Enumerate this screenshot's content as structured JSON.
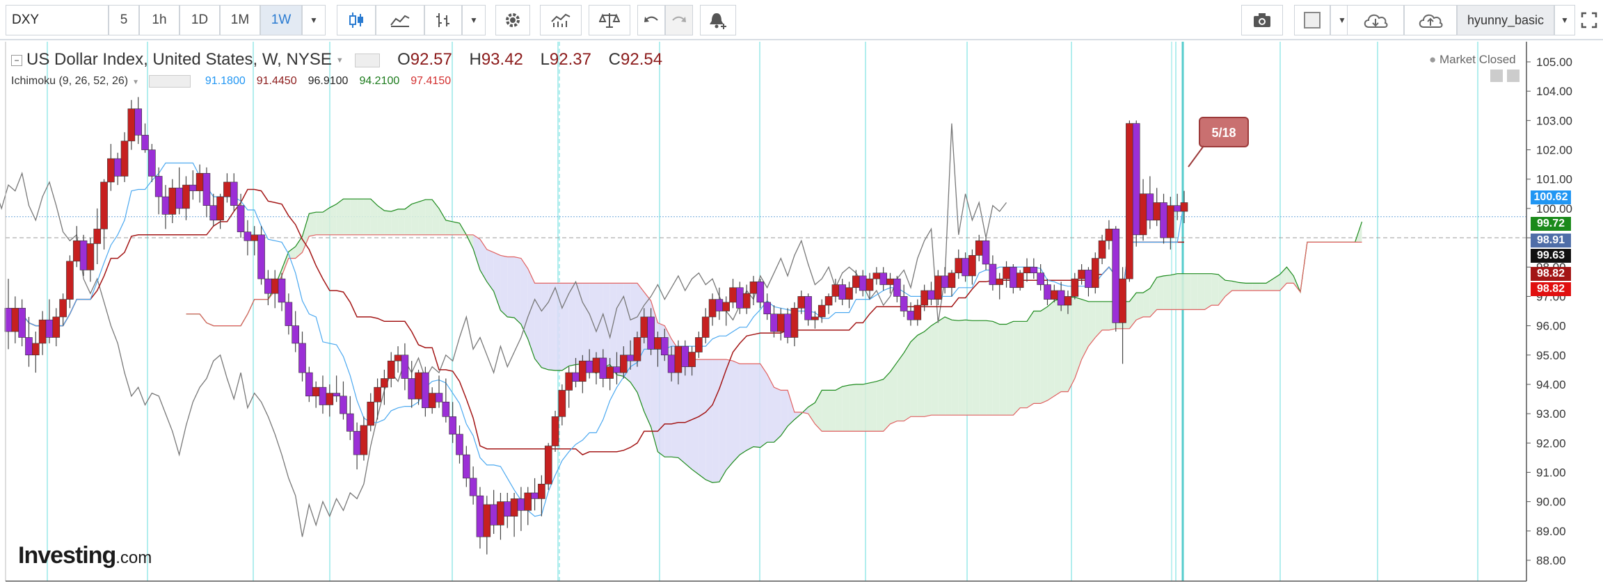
{
  "toolbar": {
    "symbol": "DXY",
    "intervals": [
      "5",
      "1h",
      "1D",
      "1M",
      "1W"
    ],
    "active_interval": "1W",
    "user": "hyunny_basic"
  },
  "legend": {
    "title": "US Dollar Index, United States, W, NYSE",
    "open_label": "O",
    "open": "92.57",
    "high_label": "H",
    "high": "93.42",
    "low_label": "L",
    "low": "92.37",
    "close_label": "C",
    "close": "92.54",
    "indicator": "Ichimoku (9, 26, 52, 26)",
    "indicator_values": [
      {
        "value": "91.1800",
        "color": "#2196f3"
      },
      {
        "value": "91.4450",
        "color": "#8b1a1a"
      },
      {
        "value": "96.9100",
        "color": "#222222"
      },
      {
        "value": "94.2100",
        "color": "#1b7a1b"
      },
      {
        "value": "97.4150",
        "color": "#d32f2f"
      }
    ]
  },
  "status": "Market Closed",
  "callout": "5/18",
  "brand": {
    "name": "Investing",
    "suffix": ".com"
  },
  "price_tags": [
    {
      "value": "100.62",
      "color": "#2196f3"
    },
    {
      "value": "99.72",
      "color": "#1b8a1b"
    },
    {
      "value": "98.91",
      "color": "#4f6ea8"
    },
    {
      "value": "99.63",
      "color": "#111111"
    },
    {
      "value": "98.82",
      "color": "#a31515"
    },
    {
      "value": "98.82",
      "color": "#e01010"
    }
  ],
  "chart_data": {
    "type": "candlestick",
    "y_axis_ticks": [
      "105.00",
      "104.00",
      "103.00",
      "102.00",
      "101.00",
      "100.00",
      "99.00",
      "98.00",
      "97.00",
      "96.00",
      "95.00",
      "94.00",
      "93.00",
      "92.00",
      "91.00",
      "90.00",
      "89.00",
      "88.00"
    ],
    "ylim": [
      87.5,
      105.5
    ],
    "ohlc": [
      [
        96.6,
        97.6,
        95.2,
        95.8
      ],
      [
        95.8,
        97.0,
        95.4,
        96.6
      ],
      [
        96.6,
        96.9,
        95.3,
        95.6
      ],
      [
        95.6,
        96.3,
        94.6,
        95.0
      ],
      [
        95.0,
        95.8,
        94.4,
        95.4
      ],
      [
        95.4,
        96.5,
        95.0,
        96.2
      ],
      [
        96.2,
        96.9,
        95.4,
        95.6
      ],
      [
        95.6,
        96.6,
        95.3,
        96.3
      ],
      [
        96.3,
        97.1,
        96.0,
        96.9
      ],
      [
        96.9,
        98.4,
        96.6,
        98.2
      ],
      [
        98.2,
        99.4,
        98.0,
        98.9
      ],
      [
        98.9,
        99.1,
        97.7,
        97.9
      ],
      [
        97.9,
        99.0,
        97.5,
        98.8
      ],
      [
        98.8,
        100.0,
        98.1,
        99.3
      ],
      [
        99.3,
        101.0,
        98.6,
        100.9
      ],
      [
        100.9,
        102.2,
        100.6,
        101.7
      ],
      [
        101.7,
        101.9,
        100.8,
        101.1
      ],
      [
        101.1,
        102.6,
        100.9,
        102.3
      ],
      [
        102.3,
        103.7,
        102.0,
        103.4
      ],
      [
        103.4,
        103.8,
        102.2,
        102.5
      ],
      [
        102.5,
        102.9,
        101.9,
        102.0
      ],
      [
        102.0,
        102.2,
        100.9,
        101.1
      ],
      [
        101.1,
        101.4,
        99.8,
        100.4
      ],
      [
        100.4,
        100.8,
        99.3,
        99.8
      ],
      [
        99.8,
        101.0,
        99.5,
        100.7
      ],
      [
        100.7,
        101.4,
        99.8,
        100.0
      ],
      [
        100.0,
        101.1,
        99.6,
        100.8
      ],
      [
        100.8,
        101.3,
        100.3,
        100.6
      ],
      [
        100.6,
        101.5,
        100.2,
        101.2
      ],
      [
        101.2,
        101.4,
        99.7,
        100.1
      ],
      [
        100.1,
        100.5,
        99.4,
        99.6
      ],
      [
        99.6,
        100.5,
        99.3,
        100.4
      ],
      [
        100.4,
        101.2,
        100.2,
        100.9
      ],
      [
        100.9,
        101.2,
        99.9,
        100.1
      ],
      [
        100.1,
        100.5,
        99.0,
        99.2
      ],
      [
        99.2,
        99.6,
        98.4,
        98.9
      ],
      [
        98.9,
        99.4,
        98.4,
        99.1
      ],
      [
        99.1,
        99.4,
        97.4,
        97.6
      ],
      [
        97.6,
        97.9,
        96.7,
        97.1
      ],
      [
        97.1,
        97.9,
        96.6,
        97.6
      ],
      [
        97.6,
        97.8,
        96.5,
        96.8
      ],
      [
        96.8,
        97.1,
        95.7,
        96.0
      ],
      [
        96.0,
        96.5,
        95.1,
        95.4
      ],
      [
        95.4,
        95.8,
        94.1,
        94.4
      ],
      [
        94.4,
        94.6,
        93.4,
        93.6
      ],
      [
        93.6,
        94.1,
        93.2,
        93.9
      ],
      [
        93.9,
        94.3,
        93.0,
        93.3
      ],
      [
        93.3,
        94.0,
        92.9,
        93.7
      ],
      [
        93.7,
        94.3,
        93.4,
        93.6
      ],
      [
        93.6,
        94.1,
        92.8,
        93.0
      ],
      [
        93.0,
        93.6,
        92.1,
        92.4
      ],
      [
        92.4,
        92.7,
        91.1,
        91.6
      ],
      [
        91.6,
        92.9,
        91.4,
        92.6
      ],
      [
        92.6,
        93.7,
        92.4,
        93.4
      ],
      [
        93.4,
        94.2,
        92.8,
        93.9
      ],
      [
        93.9,
        94.5,
        93.3,
        94.2
      ],
      [
        94.2,
        95.1,
        93.9,
        94.8
      ],
      [
        94.8,
        95.3,
        94.4,
        95.0
      ],
      [
        95.0,
        95.4,
        93.8,
        94.2
      ],
      [
        94.2,
        94.8,
        93.2,
        93.5
      ],
      [
        93.5,
        94.5,
        93.3,
        94.4
      ],
      [
        94.4,
        94.6,
        92.9,
        93.2
      ],
      [
        93.2,
        93.9,
        93.0,
        93.7
      ],
      [
        93.7,
        94.3,
        93.2,
        93.4
      ],
      [
        93.4,
        94.2,
        92.7,
        92.9
      ],
      [
        92.9,
        93.4,
        92.0,
        92.3
      ],
      [
        92.3,
        92.6,
        91.3,
        91.6
      ],
      [
        91.6,
        91.9,
        90.5,
        90.8
      ],
      [
        90.8,
        91.2,
        89.9,
        90.2
      ],
      [
        90.2,
        90.5,
        88.4,
        88.8
      ],
      [
        88.8,
        90.2,
        88.2,
        89.9
      ],
      [
        89.9,
        90.4,
        88.9,
        89.2
      ],
      [
        89.2,
        90.3,
        88.7,
        90.0
      ],
      [
        90.0,
        90.3,
        89.1,
        89.5
      ],
      [
        89.5,
        90.3,
        88.8,
        90.1
      ],
      [
        90.1,
        90.5,
        89.0,
        89.7
      ],
      [
        89.7,
        90.5,
        89.2,
        90.3
      ],
      [
        90.3,
        90.8,
        89.7,
        90.1
      ],
      [
        90.1,
        90.9,
        89.5,
        90.6
      ],
      [
        90.6,
        92.0,
        90.4,
        91.9
      ],
      [
        91.9,
        93.1,
        91.7,
        92.9
      ],
      [
        92.9,
        94.0,
        92.6,
        93.8
      ],
      [
        93.8,
        94.6,
        93.2,
        94.4
      ],
      [
        94.4,
        94.9,
        93.9,
        94.1
      ],
      [
        94.1,
        95.0,
        93.7,
        94.8
      ],
      [
        94.8,
        95.2,
        94.2,
        94.4
      ],
      [
        94.4,
        95.1,
        94.0,
        94.9
      ],
      [
        94.9,
        95.2,
        93.9,
        94.2
      ],
      [
        94.2,
        94.9,
        93.8,
        94.6
      ],
      [
        94.6,
        95.1,
        94.0,
        94.4
      ],
      [
        94.4,
        95.3,
        94.2,
        95.0
      ],
      [
        95.0,
        95.5,
        94.5,
        94.8
      ],
      [
        94.8,
        95.8,
        94.6,
        95.6
      ],
      [
        95.6,
        96.6,
        95.4,
        96.3
      ],
      [
        96.3,
        96.6,
        95.0,
        95.2
      ],
      [
        95.2,
        95.8,
        94.6,
        95.6
      ],
      [
        95.6,
        95.9,
        94.8,
        95.0
      ],
      [
        95.0,
        95.3,
        94.1,
        94.4
      ],
      [
        94.4,
        95.5,
        94.0,
        95.3
      ],
      [
        95.3,
        95.5,
        94.3,
        94.6
      ],
      [
        94.6,
        95.3,
        94.3,
        95.1
      ],
      [
        95.1,
        95.8,
        94.9,
        95.6
      ],
      [
        95.6,
        96.6,
        95.4,
        96.3
      ],
      [
        96.3,
        97.1,
        96.0,
        96.9
      ],
      [
        96.9,
        97.3,
        96.2,
        96.5
      ],
      [
        96.5,
        97.0,
        96.0,
        96.8
      ],
      [
        96.8,
        97.6,
        96.6,
        97.3
      ],
      [
        97.3,
        97.5,
        96.4,
        96.6
      ],
      [
        96.6,
        97.4,
        96.4,
        97.1
      ],
      [
        97.1,
        97.7,
        96.7,
        97.5
      ],
      [
        97.5,
        97.6,
        96.6,
        96.8
      ],
      [
        96.8,
        97.1,
        96.2,
        96.4
      ],
      [
        96.4,
        96.7,
        95.6,
        95.8
      ],
      [
        95.8,
        96.6,
        95.5,
        96.4
      ],
      [
        96.4,
        96.6,
        95.4,
        95.6
      ],
      [
        95.6,
        96.8,
        95.3,
        96.6
      ],
      [
        96.6,
        97.2,
        96.4,
        97.0
      ],
      [
        97.0,
        97.1,
        96.0,
        96.2
      ],
      [
        96.2,
        96.5,
        95.9,
        96.3
      ],
      [
        96.3,
        96.9,
        96.1,
        96.7
      ],
      [
        96.7,
        97.1,
        96.4,
        97.0
      ],
      [
        97.0,
        97.6,
        96.8,
        97.4
      ],
      [
        97.4,
        97.6,
        96.7,
        96.9
      ],
      [
        96.9,
        97.5,
        96.6,
        97.3
      ],
      [
        97.3,
        97.9,
        97.1,
        97.7
      ],
      [
        97.7,
        97.9,
        97.0,
        97.2
      ],
      [
        97.2,
        97.8,
        96.9,
        97.6
      ],
      [
        97.6,
        98.0,
        97.4,
        97.8
      ],
      [
        97.8,
        98.0,
        97.2,
        97.4
      ],
      [
        97.4,
        97.8,
        97.1,
        97.6
      ],
      [
        97.6,
        97.7,
        96.8,
        97.0
      ],
      [
        97.0,
        97.4,
        96.3,
        96.5
      ],
      [
        96.5,
        96.8,
        96.0,
        96.2
      ],
      [
        96.2,
        96.9,
        96.0,
        96.7
      ],
      [
        96.7,
        97.4,
        96.5,
        97.2
      ],
      [
        97.2,
        97.5,
        96.7,
        96.9
      ],
      [
        96.9,
        97.9,
        96.7,
        97.7
      ],
      [
        97.7,
        98.0,
        97.1,
        97.3
      ],
      [
        97.3,
        97.9,
        97.0,
        97.8
      ],
      [
        97.8,
        98.6,
        97.6,
        98.3
      ],
      [
        98.3,
        98.5,
        97.5,
        97.7
      ],
      [
        97.7,
        98.6,
        97.4,
        98.4
      ],
      [
        98.4,
        99.1,
        98.2,
        98.9
      ],
      [
        98.9,
        99.0,
        97.9,
        98.1
      ],
      [
        98.1,
        98.4,
        97.2,
        97.4
      ],
      [
        97.4,
        97.8,
        96.9,
        97.6
      ],
      [
        97.6,
        98.2,
        97.3,
        98.0
      ],
      [
        98.0,
        98.1,
        97.1,
        97.3
      ],
      [
        97.3,
        97.9,
        97.2,
        97.8
      ],
      [
        97.8,
        98.3,
        97.5,
        98.0
      ],
      [
        98.0,
        98.3,
        97.6,
        97.8
      ],
      [
        97.8,
        98.1,
        97.2,
        97.4
      ],
      [
        97.4,
        97.6,
        96.7,
        96.9
      ],
      [
        96.9,
        97.4,
        96.8,
        97.2
      ],
      [
        97.2,
        97.5,
        96.5,
        96.7
      ],
      [
        96.7,
        97.2,
        96.4,
        97.0
      ],
      [
        97.0,
        97.8,
        96.9,
        97.6
      ],
      [
        97.6,
        98.1,
        97.4,
        97.9
      ],
      [
        97.9,
        98.0,
        97.0,
        97.3
      ],
      [
        97.3,
        98.5,
        97.1,
        98.3
      ],
      [
        98.3,
        99.1,
        98.1,
        98.9
      ],
      [
        98.9,
        99.6,
        98.6,
        99.3
      ],
      [
        99.3,
        99.4,
        95.8,
        96.1
      ],
      [
        96.1,
        98.0,
        94.7,
        97.6
      ],
      [
        97.6,
        103.0,
        97.5,
        102.9
      ],
      [
        102.9,
        103.0,
        98.7,
        99.1
      ],
      [
        99.1,
        101.0,
        98.9,
        100.5
      ],
      [
        100.5,
        101.1,
        99.3,
        99.6
      ],
      [
        99.6,
        100.7,
        99.4,
        100.2
      ],
      [
        100.2,
        100.5,
        98.8,
        99.0
      ],
      [
        99.0,
        100.4,
        98.6,
        100.1
      ],
      [
        100.1,
        100.5,
        99.6,
        99.9
      ],
      [
        99.9,
        100.6,
        99.5,
        100.2
      ]
    ],
    "series": [
      {
        "name": "Conversion Line",
        "color": "#2196f3"
      },
      {
        "name": "Base Line",
        "color": "#a31515"
      },
      {
        "name": "Lagging Span",
        "color": "#555555"
      },
      {
        "name": "Leading Span A",
        "color": "#1b8a1b"
      },
      {
        "name": "Leading Span B",
        "color": "#d32f2f"
      }
    ]
  }
}
